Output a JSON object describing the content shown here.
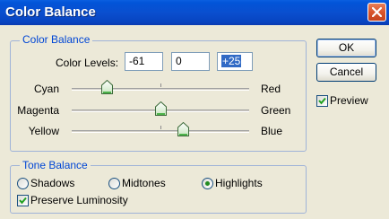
{
  "window": {
    "title": "Color Balance",
    "close_icon": "close-icon"
  },
  "color_balance": {
    "group_label": "Color Balance",
    "levels_label": "Color Levels:",
    "levels": [
      "-61",
      "0",
      "+25"
    ],
    "selected_level_index": 2,
    "sliders": [
      {
        "left_label": "Cyan",
        "right_label": "Red",
        "value": -61,
        "min": -100,
        "max": 100
      },
      {
        "left_label": "Magenta",
        "right_label": "Green",
        "value": 0,
        "min": -100,
        "max": 100
      },
      {
        "left_label": "Yellow",
        "right_label": "Blue",
        "value": 25,
        "min": -100,
        "max": 100
      }
    ]
  },
  "tone_balance": {
    "group_label": "Tone Balance",
    "options": [
      "Shadows",
      "Midtones",
      "Highlights"
    ],
    "selected": "Highlights",
    "preserve_luminosity_label": "Preserve Luminosity",
    "preserve_luminosity": true
  },
  "buttons": {
    "ok": "OK",
    "cancel": "Cancel"
  },
  "preview": {
    "label": "Preview",
    "checked": true
  },
  "colors": {
    "title_bar": "#0a4fcf",
    "group_label": "#0046d5",
    "selection": "#316ac5"
  }
}
